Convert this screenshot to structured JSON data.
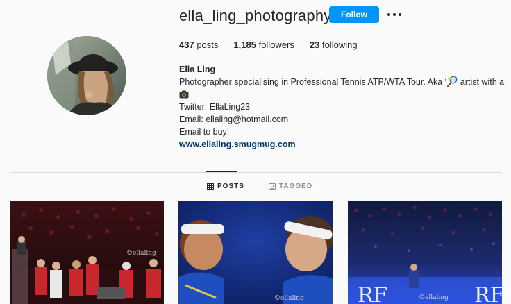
{
  "profile": {
    "username": "ella_ling_photography",
    "follow_label": "Follow",
    "stats": {
      "posts_count": "437",
      "posts_label": "posts",
      "followers_count": "1,185",
      "followers_label": "followers",
      "following_count": "23",
      "following_label": "following"
    },
    "bio": {
      "name": "Ella Ling",
      "line1": "Photographer specialising in Professional Tennis ATP/WTA Tour. Aka ‘",
      "line1_end": " artist with a",
      "twitter": "Twitter: EllaLing23",
      "email": "Email: ellaling@hotmail.com",
      "cta": "Email to buy!",
      "website": "www.ellaling.smugmug.com"
    }
  },
  "tabs": [
    {
      "label": "POSTS",
      "icon": "grid-icon",
      "active": true
    },
    {
      "label": "TAGGED",
      "icon": "tag-icon",
      "active": false
    }
  ],
  "posts": [
    {
      "watermark": "©ellaling",
      "description_icon": "team-celebration-photo"
    },
    {
      "watermark": "©ellaling",
      "description_icon": "two-players-photo"
    },
    {
      "watermark": "©ellaling",
      "description_icon": "arena-crowd-photo"
    }
  ],
  "colors": {
    "accent": "#0095f6",
    "link": "#00376b",
    "background": "#fafafa",
    "text": "#262626",
    "muted": "#8e8e8e"
  }
}
